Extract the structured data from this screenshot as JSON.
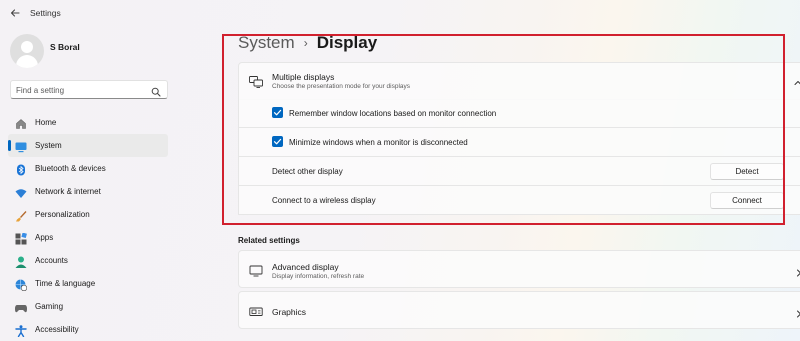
{
  "app": {
    "title": "Settings"
  },
  "user": {
    "name": "S Boral"
  },
  "search": {
    "placeholder": "Find a setting"
  },
  "sidebar": {
    "items": [
      {
        "label": "Home",
        "icon": "home-icon"
      },
      {
        "label": "System",
        "icon": "system-icon",
        "active": true
      },
      {
        "label": "Bluetooth & devices",
        "icon": "bluetooth-icon"
      },
      {
        "label": "Network & internet",
        "icon": "wifi-icon"
      },
      {
        "label": "Personalization",
        "icon": "brush-icon"
      },
      {
        "label": "Apps",
        "icon": "apps-icon"
      },
      {
        "label": "Accounts",
        "icon": "accounts-icon"
      },
      {
        "label": "Time & language",
        "icon": "globe-clock-icon"
      },
      {
        "label": "Gaming",
        "icon": "gamepad-icon"
      },
      {
        "label": "Accessibility",
        "icon": "accessibility-icon"
      }
    ]
  },
  "breadcrumb": {
    "parent": "System",
    "separator": "›",
    "current": "Display"
  },
  "multiple_displays": {
    "title": "Multiple displays",
    "subtitle": "Choose the presentation mode for your displays",
    "options": [
      {
        "label": "Remember window locations based on monitor connection",
        "checked": true
      },
      {
        "label": "Minimize windows when a monitor is disconnected",
        "checked": true
      }
    ],
    "detect": {
      "label": "Detect other display",
      "button": "Detect"
    },
    "wireless": {
      "label": "Connect to a wireless display",
      "button": "Connect"
    }
  },
  "related": {
    "title": "Related settings",
    "items": [
      {
        "title": "Advanced display",
        "subtitle": "Display information, refresh rate",
        "icon": "monitor-icon"
      },
      {
        "title": "Graphics",
        "subtitle": "",
        "icon": "graphics-icon"
      }
    ]
  },
  "colors": {
    "accent": "#0067c0",
    "highlight_box": "#d1202e"
  }
}
